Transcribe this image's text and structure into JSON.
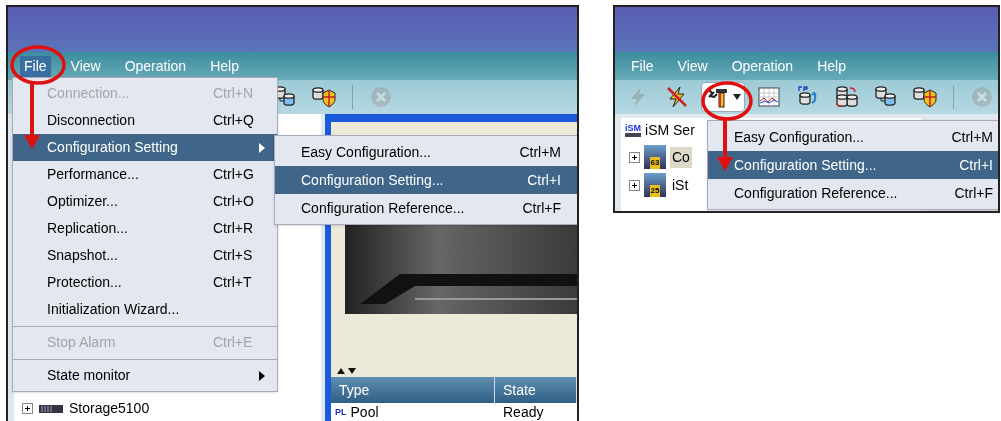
{
  "left_screen": {
    "menu_bar": [
      {
        "label": "File",
        "selected": true
      },
      {
        "label": "View",
        "selected": false
      },
      {
        "label": "Operation",
        "selected": false
      },
      {
        "label": "Help",
        "selected": false
      }
    ],
    "toolbar": [
      {
        "kind": "volume-pair",
        "disabled": false,
        "pressed": false
      },
      {
        "kind": "shield",
        "disabled": false,
        "pressed": false
      },
      {
        "kind": "stop",
        "disabled": true,
        "pressed": false
      }
    ],
    "file_menu": [
      {
        "kind": "item",
        "label": "Connection...",
        "shortcut": "Ctrl+N",
        "disabled": true,
        "selected": false
      },
      {
        "kind": "item",
        "label": "Disconnection",
        "shortcut": "Ctrl+Q",
        "disabled": false,
        "selected": false
      },
      {
        "kind": "submenu",
        "label": "Configuration Setting",
        "disabled": false,
        "selected": true
      },
      {
        "kind": "item",
        "label": "Performance...",
        "shortcut": "Ctrl+G",
        "disabled": false,
        "selected": false
      },
      {
        "kind": "item",
        "label": "Optimizer...",
        "shortcut": "Ctrl+O",
        "disabled": false,
        "selected": false
      },
      {
        "kind": "item",
        "label": "Replication...",
        "shortcut": "Ctrl+R",
        "disabled": false,
        "selected": false
      },
      {
        "kind": "item",
        "label": "Snapshot...",
        "shortcut": "Ctrl+S",
        "disabled": false,
        "selected": false
      },
      {
        "kind": "item",
        "label": "Protection...",
        "shortcut": "Ctrl+T",
        "disabled": false,
        "selected": false
      },
      {
        "kind": "item",
        "label": "Initialization Wizard...",
        "disabled": false,
        "selected": false
      },
      {
        "kind": "separator"
      },
      {
        "kind": "item",
        "label": "Stop Alarm",
        "shortcut": "Ctrl+E",
        "disabled": true,
        "selected": false
      },
      {
        "kind": "separator"
      },
      {
        "kind": "submenu",
        "label": "State monitor",
        "disabled": false,
        "selected": false
      }
    ],
    "submenu": [
      {
        "label": "Easy Configuration...",
        "shortcut": "Ctrl+M",
        "selected": false
      },
      {
        "label": "Configuration Setting...",
        "shortcut": "Ctrl+I",
        "selected": true
      },
      {
        "label": "Configuration Reference...",
        "shortcut": "Ctrl+F",
        "selected": false
      }
    ],
    "tree": [
      {
        "label": "Storage5100",
        "expanded": false
      }
    ],
    "table": {
      "columns": [
        "Type",
        "State"
      ],
      "rows": [
        {
          "icon_label": "PL",
          "cells": [
            "Pool",
            "Ready"
          ]
        }
      ]
    }
  },
  "right_screen": {
    "menu_bar": [
      {
        "label": "File",
        "selected": false
      },
      {
        "label": "View",
        "selected": false
      },
      {
        "label": "Operation",
        "selected": false
      },
      {
        "label": "Help",
        "selected": false
      }
    ],
    "toolbar": [
      {
        "kind": "connect",
        "disabled": true,
        "pressed": false
      },
      {
        "kind": "disconnect",
        "disabled": false,
        "pressed": false
      },
      {
        "kind": "tools",
        "disabled": false,
        "pressed": true
      },
      {
        "kind": "chart",
        "disabled": false,
        "pressed": false
      },
      {
        "kind": "volume-up",
        "disabled": false,
        "pressed": false
      },
      {
        "kind": "volume-sync",
        "disabled": false,
        "pressed": false
      },
      {
        "kind": "volume-pair",
        "disabled": false,
        "pressed": false
      },
      {
        "kind": "shield",
        "disabled": false,
        "pressed": false
      },
      {
        "kind": "stop",
        "disabled": true,
        "pressed": false
      }
    ],
    "tree": [
      {
        "label": "iSM Ser",
        "icon_label": "iSM",
        "children": [
          {
            "label": "Co",
            "icon_label": "63",
            "expanded": false,
            "selected": true
          },
          {
            "label": "iSt",
            "icon_label": "25",
            "expanded": false,
            "selected": false
          }
        ]
      }
    ],
    "dropdown": [
      {
        "label": "Easy Configuration...",
        "shortcut": "Ctrl+M",
        "selected": false
      },
      {
        "label": "Configuration Setting...",
        "shortcut": "Ctrl+I",
        "selected": true
      },
      {
        "label": "Configuration Reference...",
        "shortcut": "Ctrl+F",
        "selected": false
      }
    ]
  }
}
